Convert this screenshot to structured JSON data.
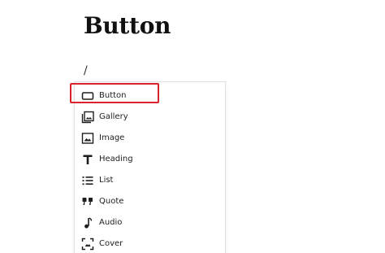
{
  "page": {
    "title": "Button",
    "slash_text": "/"
  },
  "inserter": {
    "items": [
      {
        "label": "Button",
        "icon": "button-icon"
      },
      {
        "label": "Gallery",
        "icon": "gallery-icon"
      },
      {
        "label": "Image",
        "icon": "image-icon"
      },
      {
        "label": "Heading",
        "icon": "heading-icon"
      },
      {
        "label": "List",
        "icon": "list-icon"
      },
      {
        "label": "Quote",
        "icon": "quote-icon"
      },
      {
        "label": "Audio",
        "icon": "audio-icon"
      },
      {
        "label": "Cover",
        "icon": "cover-icon"
      }
    ],
    "selected_index": 0
  },
  "colors": {
    "highlight": "#d9232d",
    "text": "#1e1e1e",
    "border": "#e0e0e0"
  }
}
